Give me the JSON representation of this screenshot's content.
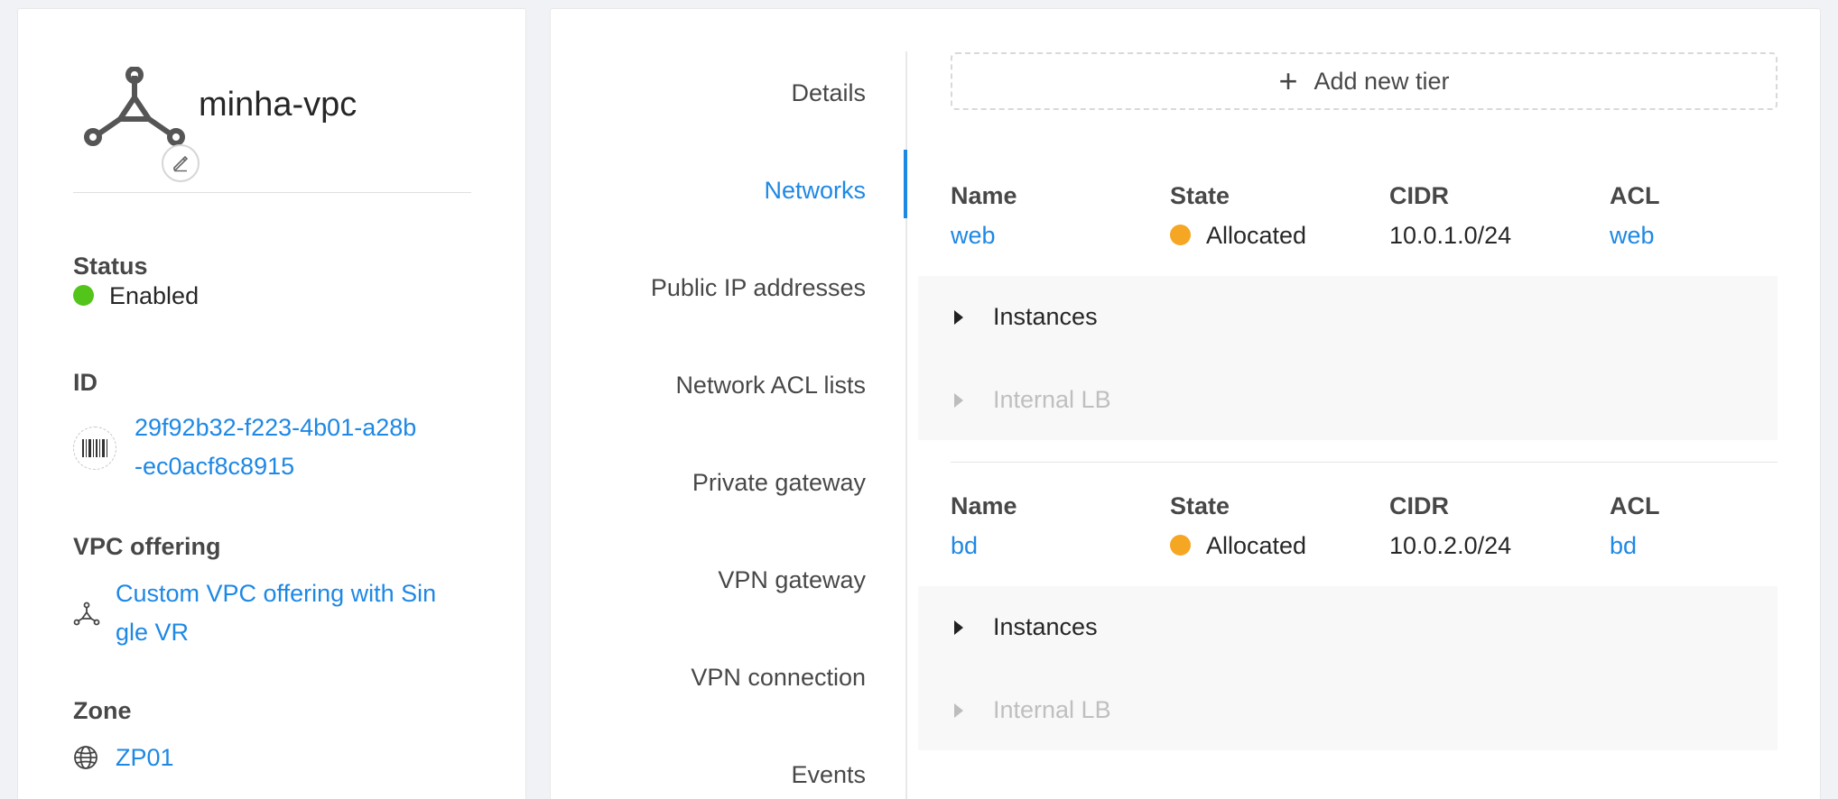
{
  "vpc": {
    "name": "minha-vpc"
  },
  "details": {
    "status_label": "Status",
    "status_value": "Enabled",
    "status_color": "#52c41a",
    "id_label": "ID",
    "id_line1": "29f92b32-f223-4b01-a28b",
    "id_line2": "-ec0acf8c8915",
    "offering_label": "VPC offering",
    "offering_line1": "Custom VPC offering with Sin",
    "offering_line2": "gle VR",
    "zone_label": "Zone",
    "zone_value": "ZP01"
  },
  "tabs": [
    {
      "label": "Details"
    },
    {
      "label": "Networks",
      "active": true
    },
    {
      "label": "Public IP addresses"
    },
    {
      "label": "Network ACL lists"
    },
    {
      "label": "Private gateway"
    },
    {
      "label": "VPN gateway"
    },
    {
      "label": "VPN connection"
    },
    {
      "label": "Events"
    }
  ],
  "add_tier_label": "Add new tier",
  "columns": {
    "name": "Name",
    "state": "State",
    "cidr": "CIDR",
    "acl": "ACL"
  },
  "tiers": [
    {
      "name": "web",
      "state": "Allocated",
      "cidr": "10.0.1.0/24",
      "acl": "web",
      "instances_label": "Instances",
      "lb_label": "Internal LB"
    },
    {
      "name": "bd",
      "state": "Allocated",
      "cidr": "10.0.2.0/24",
      "acl": "bd",
      "instances_label": "Instances",
      "lb_label": "Internal LB"
    }
  ],
  "colors": {
    "accent": "#1e88e5",
    "allocated": "#f5a623",
    "enabled": "#52c41a"
  },
  "icons": {
    "vpc": "vpc-icon",
    "edit": "edit-icon",
    "barcode": "barcode-icon",
    "offering": "vpc-offering-icon",
    "zone": "globe-icon",
    "add": "plus-icon",
    "expand": "caret-right-icon"
  }
}
